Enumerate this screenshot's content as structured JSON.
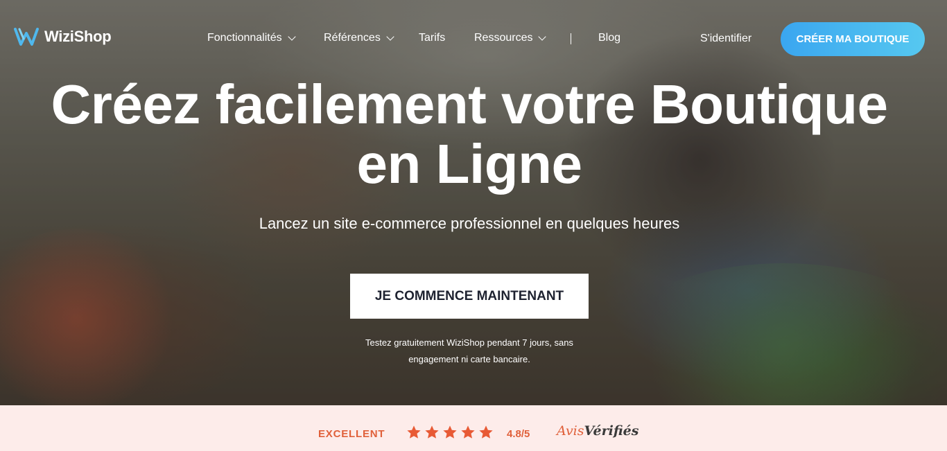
{
  "brand": {
    "name": "WiziShop",
    "accent": "#3aa6f0"
  },
  "nav": {
    "items": [
      {
        "label": "Fonctionnalités",
        "has_dropdown": true
      },
      {
        "label": "Références",
        "has_dropdown": true
      },
      {
        "label": "Tarifs",
        "has_dropdown": false
      },
      {
        "label": "Ressources",
        "has_dropdown": true
      },
      {
        "label": "Blog",
        "has_dropdown": false
      }
    ],
    "signin": "S'identifier",
    "cta": "CRÉER MA BOUTIQUE"
  },
  "hero": {
    "headline_line1": "Créez facilement votre Boutique",
    "headline_line2": "en Ligne",
    "subtitle": "Lancez un site e-commerce professionnel en quelques heures",
    "cta": "JE COMMENCE MAINTENANT",
    "trial_line1": "Testez gratuitement WiziShop pendant 7 jours, sans",
    "trial_line2": "engagement ni carte bancaire."
  },
  "ratings": {
    "label": "EXCELLENT",
    "stars": 5,
    "score": "4.8/5",
    "provider_part1": "Avis",
    "provider_part2": "Vérifiés",
    "accent": "#e0603a"
  }
}
